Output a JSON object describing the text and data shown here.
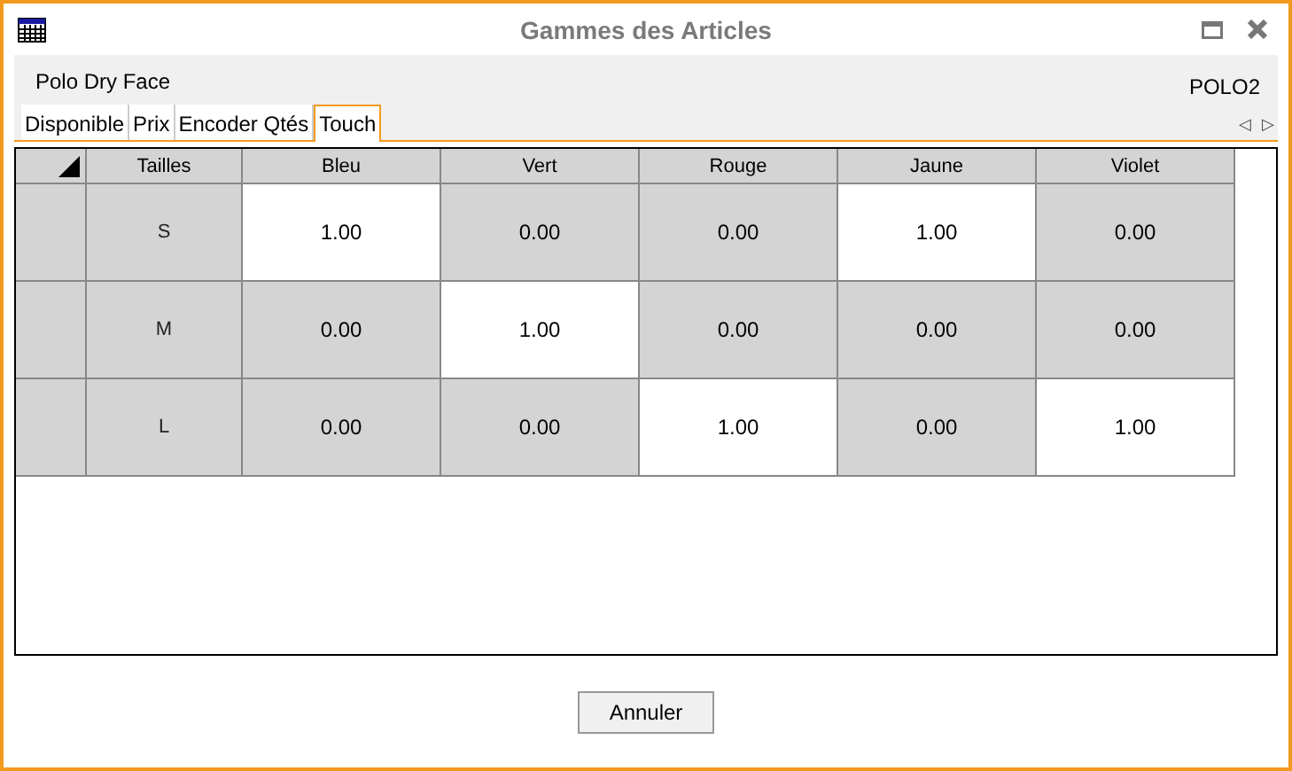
{
  "window": {
    "title": "Gammes des Articles"
  },
  "article": {
    "name": "Polo Dry Face",
    "code": "POLO2"
  },
  "tabs": [
    {
      "label": "Disponible",
      "selected": false
    },
    {
      "label": "Prix",
      "selected": false
    },
    {
      "label": "Encoder Qtés",
      "selected": false
    },
    {
      "label": "Touch",
      "selected": true
    }
  ],
  "tab_scroll": {
    "left": "◁",
    "right": "▷"
  },
  "table": {
    "columns": [
      "Tailles",
      "Bleu",
      "Vert",
      "Rouge",
      "Jaune",
      "Violet"
    ],
    "rows": [
      {
        "cells": [
          {
            "kind": "size",
            "value": "S",
            "highlighted": false
          },
          {
            "kind": "quantity",
            "value": "1.00",
            "highlighted": true
          },
          {
            "kind": "quantity",
            "value": "0.00",
            "highlighted": false
          },
          {
            "kind": "quantity",
            "value": "0.00",
            "highlighted": false
          },
          {
            "kind": "quantity",
            "value": "1.00",
            "highlighted": true
          },
          {
            "kind": "quantity",
            "value": "0.00",
            "highlighted": false
          }
        ]
      },
      {
        "cells": [
          {
            "kind": "size",
            "value": "M",
            "highlighted": false
          },
          {
            "kind": "quantity",
            "value": "0.00",
            "highlighted": false
          },
          {
            "kind": "quantity",
            "value": "1.00",
            "highlighted": true
          },
          {
            "kind": "quantity",
            "value": "0.00",
            "highlighted": false
          },
          {
            "kind": "quantity",
            "value": "0.00",
            "highlighted": false
          },
          {
            "kind": "quantity",
            "value": "0.00",
            "highlighted": false
          }
        ]
      },
      {
        "cells": [
          {
            "kind": "size",
            "value": "L",
            "highlighted": false
          },
          {
            "kind": "quantity",
            "value": "0.00",
            "highlighted": false
          },
          {
            "kind": "quantity",
            "value": "0.00",
            "highlighted": false
          },
          {
            "kind": "quantity",
            "value": "1.00",
            "highlighted": true
          },
          {
            "kind": "quantity",
            "value": "0.00",
            "highlighted": false
          },
          {
            "kind": "quantity",
            "value": "1.00",
            "highlighted": true
          }
        ]
      }
    ]
  },
  "buttons": [
    "Annuler"
  ]
}
